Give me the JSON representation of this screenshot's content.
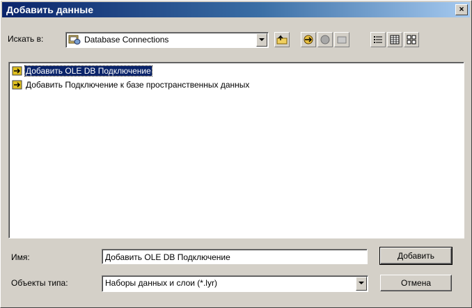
{
  "window": {
    "title": "Добавить данные",
    "close_glyph": "×"
  },
  "lookin": {
    "label": "Искать в:",
    "value": "Database Connections"
  },
  "files": [
    {
      "label": "Добавить OLE DB Подключение",
      "icon": "add-connection-icon",
      "selected": true
    },
    {
      "label": "Добавить Подключение к базе пространственных данных",
      "icon": "add-connection-icon",
      "selected": false
    }
  ],
  "name_field": {
    "label": "Имя:",
    "value": "Добавить OLE DB Подключение"
  },
  "type_field": {
    "label": "Объекты типа:",
    "value": "Наборы данных и слои (*.lyr)"
  },
  "buttons": {
    "add": "Добавить",
    "cancel": "Отмена"
  }
}
